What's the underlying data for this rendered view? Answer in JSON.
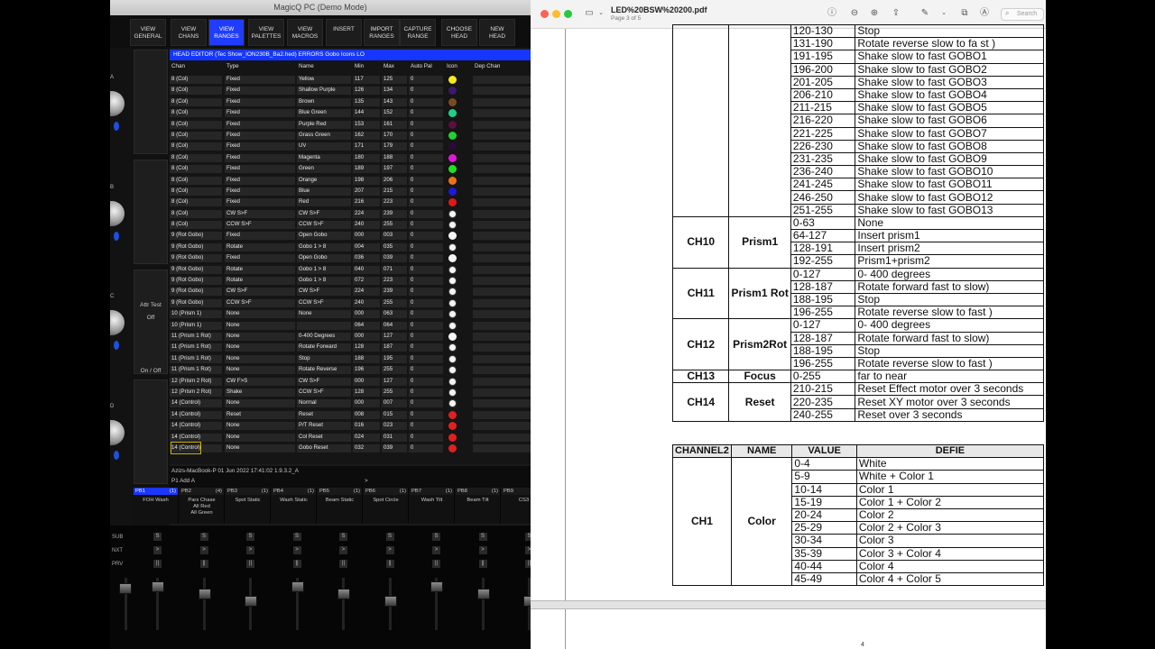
{
  "magicq": {
    "title": "MagicQ PC (Demo Mode)",
    "toolbar": [
      {
        "label": "VIEW\nGENERAL",
        "active": false
      },
      {
        "label": "VIEW\nCHANS",
        "active": false
      },
      {
        "label": "VIEW\nRANGES",
        "active": true
      },
      {
        "label": "VIEW\nPALETTES",
        "active": false
      },
      {
        "label": "VIEW\nMACROS",
        "active": false
      },
      {
        "label": "INSERT",
        "active": false
      },
      {
        "label": "IMPORT\nRANGES",
        "active": false
      },
      {
        "label": "CAPTURE\nRANGE",
        "active": false
      },
      {
        "label": "CHOOSE\nHEAD",
        "active": false
      },
      {
        "label": "NEW\nHEAD",
        "active": false
      }
    ],
    "side_labels": [
      "A",
      "B",
      "C",
      "D"
    ],
    "attr_test": "Attr Test",
    "attr_off": "Off",
    "on_off": "On / Off",
    "head_editor_title": "HEAD EDITOR (Tec Show_ION230B_Ba2.hed) ERRORS Gobo Icons LO",
    "columns": [
      "Chan",
      "Type",
      "Name",
      "Min",
      "Max",
      "Auto Pal",
      "Icon",
      "Dep Chan"
    ],
    "rows": [
      [
        "8 (Col)",
        "Fixed",
        "Yellow",
        "117",
        "125",
        "0",
        "#f6e81c"
      ],
      [
        "8 (Col)",
        "Fixed",
        "Shallow Purple",
        "126",
        "134",
        "0",
        "#3a1a6a"
      ],
      [
        "8 (Col)",
        "Fixed",
        "Brown",
        "135",
        "143",
        "0",
        "#7a4a20"
      ],
      [
        "8 (Col)",
        "Fixed",
        "Blue Green",
        "144",
        "152",
        "0",
        "#1ed08a"
      ],
      [
        "8 (Col)",
        "Fixed",
        "Purple Red",
        "153",
        "161",
        "0",
        "#5a103a"
      ],
      [
        "8 (Col)",
        "Fixed",
        "Grass Green",
        "162",
        "170",
        "0",
        "#22d030"
      ],
      [
        "8 (Col)",
        "Fixed",
        "UV",
        "171",
        "179",
        "0",
        "#2a0a3a"
      ],
      [
        "8 (Col)",
        "Fixed",
        "Magenta",
        "180",
        "188",
        "0",
        "#e018d8"
      ],
      [
        "8 (Col)",
        "Fixed",
        "Green",
        "189",
        "197",
        "0",
        "#20e020"
      ],
      [
        "8 (Col)",
        "Fixed",
        "Orange",
        "198",
        "206",
        "0",
        "#f07018"
      ],
      [
        "8 (Col)",
        "Fixed",
        "Blue",
        "207",
        "215",
        "0",
        "#1a1ad8"
      ],
      [
        "8 (Col)",
        "Fixed",
        "Red",
        "216",
        "223",
        "0",
        "#e01818"
      ],
      [
        "8 (Col)",
        "CW S>F",
        "CW S>F",
        "224",
        "239",
        "0",
        "gobo"
      ],
      [
        "8 (Col)",
        "CCW S>F",
        "CCW S>F",
        "240",
        "255",
        "0",
        "gobo"
      ],
      [
        "9 (Rot Gobo)",
        "Fixed",
        "Open Gobo",
        "000",
        "003",
        "0",
        "#f4f4f4"
      ],
      [
        "9 (Rot Gobo)",
        "Rotate",
        "Gobo 1 > 8",
        "004",
        "035",
        "0",
        "gobo"
      ],
      [
        "9 (Rot Gobo)",
        "Fixed",
        "Open Gobo",
        "036",
        "039",
        "0",
        "#f4f4f4"
      ],
      [
        "9 (Rot Gobo)",
        "Rotate",
        "Gobo 1 > 8",
        "040",
        "071",
        "0",
        "gobo"
      ],
      [
        "9 (Rot Gobo)",
        "Rotate",
        "Gobo 1 > 8",
        "072",
        "223",
        "0",
        "gobo"
      ],
      [
        "9 (Rot Gobo)",
        "CW S>F",
        "CW S>F",
        "224",
        "239",
        "0",
        "gobo"
      ],
      [
        "9 (Rot Gobo)",
        "CCW S>F",
        "CCW S>F",
        "240",
        "255",
        "0",
        "gobo"
      ],
      [
        "10 (Prism 1)",
        "None",
        "None",
        "000",
        "063",
        "0",
        "gobo"
      ],
      [
        "10 (Prism 1)",
        "None",
        "",
        "064",
        "064",
        "0",
        "gobo"
      ],
      [
        "11 (Prism 1 Rot)",
        "None",
        "0-400 Degrees",
        "000",
        "127",
        "0",
        "#f4f4f4"
      ],
      [
        "11 (Prism 1 Rot)",
        "None",
        "Rotate Forward",
        "128",
        "187",
        "0",
        "gobo"
      ],
      [
        "11 (Prism 1 Rot)",
        "None",
        "Stop",
        "188",
        "195",
        "0",
        "gobo"
      ],
      [
        "11 (Prism 1 Rot)",
        "None",
        "Rotate Reverse",
        "196",
        "255",
        "0",
        "gobo"
      ],
      [
        "12 (Prism 2 Rot)",
        "CW F>S",
        "CW S>F",
        "000",
        "127",
        "0",
        "gobo"
      ],
      [
        "12 (Prism 2 Rot)",
        "Shake",
        "CCW S>F",
        "128",
        "255",
        "0",
        "gobo"
      ],
      [
        "14 (Control)",
        "None",
        "Normal",
        "000",
        "007",
        "0",
        "gobo"
      ],
      [
        "14 (Control)",
        "Reset",
        "Reset",
        "008",
        "015",
        "0",
        "#e02020"
      ],
      [
        "14 (Control)",
        "None",
        "P/T Reset",
        "016",
        "023",
        "0",
        "#e02020"
      ],
      [
        "14 (Control)",
        "None",
        "Col Reset",
        "024",
        "031",
        "0",
        "#e02020"
      ],
      [
        "14 (Control)",
        "None",
        "Gobo Reset",
        "032",
        "039",
        "0",
        "#e02020"
      ]
    ],
    "status_line": "Azizs-MacBook-P 01 Jun 2022 17:41:02 1.9.3.2_A",
    "command_line": "P1  Add A",
    "prompt": ">",
    "playbacks": [
      {
        "id": "PB1",
        "count": "(1)",
        "name": "FOH Wash"
      },
      {
        "id": "PB2",
        "count": "(4)",
        "name": "Pars Chase\nAll Red\nAll Green"
      },
      {
        "id": "PB3",
        "count": "(1)",
        "name": "Spot Static"
      },
      {
        "id": "PB4",
        "count": "(1)",
        "name": "Wash Static"
      },
      {
        "id": "PB5",
        "count": "(1)",
        "name": "Beam Static"
      },
      {
        "id": "PB6",
        "count": "(1)",
        "name": "Spot Circle"
      },
      {
        "id": "PB7",
        "count": "(1)",
        "name": "Wash Tilt"
      },
      {
        "id": "PB8",
        "count": "(1)",
        "name": "Beam Tilt"
      },
      {
        "id": "PB9",
        "count": "(1)",
        "name": "CS3"
      }
    ],
    "fader_labels": [
      "SUB",
      "NXT",
      "PRV"
    ],
    "fader_buttons": [
      "S",
      ">",
      "||"
    ]
  },
  "preview": {
    "file_name": "LED%20BSW%20200.pdf",
    "page_info": "Page 3 of 5",
    "search_placeholder": "Search",
    "page_number": "4",
    "table1": [
      [
        "",
        "",
        "120-130",
        "Stop"
      ],
      [
        "",
        "",
        "131-190",
        "Rotate reverse slow to fa st )"
      ],
      [
        "",
        "",
        "191-195",
        "Shake slow to fast  GOBO1"
      ],
      [
        "",
        "",
        "196-200",
        "Shake slow to fast  GOBO2"
      ],
      [
        "",
        "",
        "201-205",
        "Shake slow to fast  GOBO3"
      ],
      [
        "",
        "",
        "206-210",
        "Shake slow to fast  GOBO4"
      ],
      [
        "",
        "",
        "211-215",
        "Shake slow to fast  GOBO5"
      ],
      [
        "",
        "",
        "216-220",
        "Shake slow to fast  GOBO6"
      ],
      [
        "",
        "",
        "221-225",
        "Shake slow to fast  GOBO7"
      ],
      [
        "",
        "",
        "226-230",
        "Shake slow to fast  GOBO8"
      ],
      [
        "",
        "",
        "231-235",
        "Shake slow to fast  GOBO9"
      ],
      [
        "",
        "",
        "236-240",
        "Shake slow to fast  GOBO10"
      ],
      [
        "",
        "",
        "241-245",
        "Shake slow to fast  GOBO11"
      ],
      [
        "",
        "",
        "246-250",
        "Shake slow to fast  GOBO12"
      ],
      [
        "",
        "",
        "251-255",
        "Shake slow to fast  GOBO13"
      ]
    ],
    "table1_groups": [
      {
        "ch": "CH10",
        "name": "Prism1",
        "rows": [
          [
            "0-63",
            "None"
          ],
          [
            "64-127",
            "Insert prism1"
          ],
          [
            "128-191",
            "Insert prism2"
          ],
          [
            "192-255",
            "Prism1+prism2"
          ]
        ]
      },
      {
        "ch": "CH11",
        "name": "Prism1 Rot",
        "rows": [
          [
            "0-127",
            "0- 400 degrees"
          ],
          [
            "128-187",
            "Rotate forward fast to slow)"
          ],
          [
            "188-195",
            "Stop"
          ],
          [
            "196-255",
            "Rotate reverse slow to fast )"
          ]
        ]
      },
      {
        "ch": "CH12",
        "name": "Prism2Rot",
        "rows": [
          [
            "0-127",
            "0- 400 degrees"
          ],
          [
            "128-187",
            "Rotate forward fast to slow)"
          ],
          [
            "188-195",
            "Stop"
          ],
          [
            "196-255",
            "Rotate reverse slow to fast )"
          ]
        ]
      },
      {
        "ch": "CH13",
        "name": "Focus",
        "rows": [
          [
            "0-255",
            "far to near"
          ]
        ]
      },
      {
        "ch": "CH14",
        "name": "Reset",
        "rows": [
          [
            "210-215",
            "Reset Effect motor over 3 seconds"
          ],
          [
            "220-235",
            "Reset XY motor over 3 seconds"
          ],
          [
            "240-255",
            "Reset over 3 seconds"
          ]
        ]
      }
    ],
    "table2_headers": [
      "CHANNEL2",
      "NAME",
      "VALUE",
      "DEFIE"
    ],
    "table2": {
      "ch": "CH1",
      "name": "Color",
      "rows": [
        [
          "0-4",
          "White"
        ],
        [
          "5-9",
          "White + Color 1"
        ],
        [
          "10-14",
          "Color 1"
        ],
        [
          "15-19",
          "Color 1 + Color 2"
        ],
        [
          "20-24",
          "Color 2"
        ],
        [
          "25-29",
          "Color 2 + Color 3"
        ],
        [
          "30-34",
          "Color 3"
        ],
        [
          "35-39",
          "Color 3 + Color 4"
        ],
        [
          "40-44",
          "Color 4"
        ],
        [
          "45-49",
          "Color 4 + Color 5"
        ]
      ]
    }
  }
}
